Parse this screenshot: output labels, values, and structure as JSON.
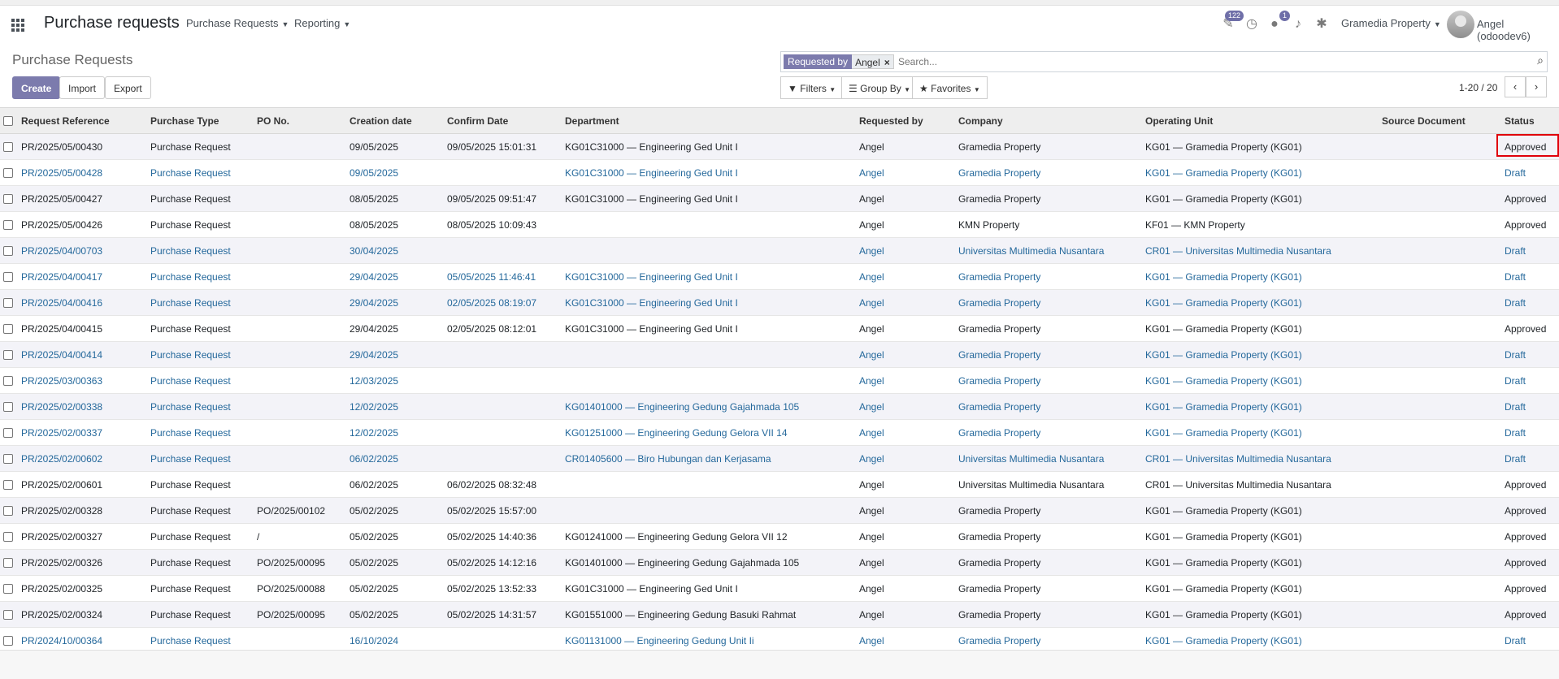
{
  "app": {
    "brand": "Purchase requests",
    "menus": [
      "Purchase Requests",
      "Reporting"
    ],
    "activity_badge": "122",
    "chat_badge": "1",
    "company": "Gramedia Property",
    "user": "Angel (odoodev6)"
  },
  "control": {
    "title": "Purchase Requests",
    "create_label": "Create",
    "import_label": "Import",
    "export_label": "Export",
    "facet_label": "Requested by",
    "facet_value": "Angel",
    "search_placeholder": "Search...",
    "filters_label": "Filters",
    "groupby_label": "Group By",
    "favorites_label": "Favorites",
    "pager": "1-20 / 20"
  },
  "table": {
    "columns": [
      "Request Reference",
      "Purchase Type",
      "PO No.",
      "Creation date",
      "Confirm Date",
      "Department",
      "Requested by",
      "Company",
      "Operating Unit",
      "Source Document",
      "Status"
    ],
    "rows": [
      [
        "PR/2025/05/00430",
        "Purchase Request",
        "",
        "09/05/2025",
        "09/05/2025 15:01:31",
        "KG01C31000 — Engineering Ged Unit I",
        "Angel",
        "Gramedia Property",
        "KG01 — Gramedia Property (KG01)",
        "",
        "Approved"
      ],
      [
        "PR/2025/05/00428",
        "Purchase Request",
        "",
        "09/05/2025",
        "",
        "KG01C31000 — Engineering Ged Unit I",
        "Angel",
        "Gramedia Property",
        "KG01 — Gramedia Property (KG01)",
        "",
        "Draft"
      ],
      [
        "PR/2025/05/00427",
        "Purchase Request",
        "",
        "08/05/2025",
        "09/05/2025 09:51:47",
        "KG01C31000 — Engineering Ged Unit I",
        "Angel",
        "Gramedia Property",
        "KG01 — Gramedia Property (KG01)",
        "",
        "Approved"
      ],
      [
        "PR/2025/05/00426",
        "Purchase Request",
        "",
        "08/05/2025",
        "08/05/2025 10:09:43",
        "",
        "Angel",
        "KMN Property",
        "KF01 — KMN Property",
        "",
        "Approved"
      ],
      [
        "PR/2025/04/00703",
        "Purchase Request",
        "",
        "30/04/2025",
        "",
        "",
        "Angel",
        "Universitas Multimedia Nusantara",
        "CR01 — Universitas Multimedia Nusantara",
        "",
        "Draft"
      ],
      [
        "PR/2025/04/00417",
        "Purchase Request",
        "",
        "29/04/2025",
        "05/05/2025 11:46:41",
        "KG01C31000 — Engineering Ged Unit I",
        "Angel",
        "Gramedia Property",
        "KG01 — Gramedia Property (KG01)",
        "",
        "Draft"
      ],
      [
        "PR/2025/04/00416",
        "Purchase Request",
        "",
        "29/04/2025",
        "02/05/2025 08:19:07",
        "KG01C31000 — Engineering Ged Unit I",
        "Angel",
        "Gramedia Property",
        "KG01 — Gramedia Property (KG01)",
        "",
        "Draft"
      ],
      [
        "PR/2025/04/00415",
        "Purchase Request",
        "",
        "29/04/2025",
        "02/05/2025 08:12:01",
        "KG01C31000 — Engineering Ged Unit I",
        "Angel",
        "Gramedia Property",
        "KG01 — Gramedia Property (KG01)",
        "",
        "Approved"
      ],
      [
        "PR/2025/04/00414",
        "Purchase Request",
        "",
        "29/04/2025",
        "",
        "",
        "Angel",
        "Gramedia Property",
        "KG01 — Gramedia Property (KG01)",
        "",
        "Draft"
      ],
      [
        "PR/2025/03/00363",
        "Purchase Request",
        "",
        "12/03/2025",
        "",
        "",
        "Angel",
        "Gramedia Property",
        "KG01 — Gramedia Property (KG01)",
        "",
        "Draft"
      ],
      [
        "PR/2025/02/00338",
        "Purchase Request",
        "",
        "12/02/2025",
        "",
        "KG01401000 — Engineering Gedung Gajahmada 105",
        "Angel",
        "Gramedia Property",
        "KG01 — Gramedia Property (KG01)",
        "",
        "Draft"
      ],
      [
        "PR/2025/02/00337",
        "Purchase Request",
        "",
        "12/02/2025",
        "",
        "KG01251000 — Engineering Gedung Gelora VII 14",
        "Angel",
        "Gramedia Property",
        "KG01 — Gramedia Property (KG01)",
        "",
        "Draft"
      ],
      [
        "PR/2025/02/00602",
        "Purchase Request",
        "",
        "06/02/2025",
        "",
        "CR01405600 — Biro Hubungan dan Kerjasama",
        "Angel",
        "Universitas Multimedia Nusantara",
        "CR01 — Universitas Multimedia Nusantara",
        "",
        "Draft"
      ],
      [
        "PR/2025/02/00601",
        "Purchase Request",
        "",
        "06/02/2025",
        "06/02/2025 08:32:48",
        "",
        "Angel",
        "Universitas Multimedia Nusantara",
        "CR01 — Universitas Multimedia Nusantara",
        "",
        "Approved"
      ],
      [
        "PR/2025/02/00328",
        "Purchase Request",
        "PO/2025/00102",
        "05/02/2025",
        "05/02/2025 15:57:00",
        "",
        "Angel",
        "Gramedia Property",
        "KG01 — Gramedia Property (KG01)",
        "",
        "Approved"
      ],
      [
        "PR/2025/02/00327",
        "Purchase Request",
        "/",
        "05/02/2025",
        "05/02/2025 14:40:36",
        "KG01241000 — Engineering Gedung Gelora VII 12",
        "Angel",
        "Gramedia Property",
        "KG01 — Gramedia Property (KG01)",
        "",
        "Approved"
      ],
      [
        "PR/2025/02/00326",
        "Purchase Request",
        "PO/2025/00095",
        "05/02/2025",
        "05/02/2025 14:12:16",
        "KG01401000 — Engineering Gedung Gajahmada 105",
        "Angel",
        "Gramedia Property",
        "KG01 — Gramedia Property (KG01)",
        "",
        "Approved"
      ],
      [
        "PR/2025/02/00325",
        "Purchase Request",
        "PO/2025/00088",
        "05/02/2025",
        "05/02/2025 13:52:33",
        "KG01C31000 — Engineering Ged Unit I",
        "Angel",
        "Gramedia Property",
        "KG01 — Gramedia Property (KG01)",
        "",
        "Approved"
      ],
      [
        "PR/2025/02/00324",
        "Purchase Request",
        "PO/2025/00095",
        "05/02/2025",
        "05/02/2025 14:31:57",
        "KG01551000 — Engineering Gedung Basuki Rahmat",
        "Angel",
        "Gramedia Property",
        "KG01 — Gramedia Property (KG01)",
        "",
        "Approved"
      ],
      [
        "PR/2024/10/00364",
        "Purchase Request",
        "",
        "16/10/2024",
        "",
        "KG01131000 — Engineering Gedung Unit Ii",
        "Angel",
        "Gramedia Property",
        "KG01 — Gramedia Property (KG01)",
        "",
        "Draft"
      ]
    ]
  }
}
